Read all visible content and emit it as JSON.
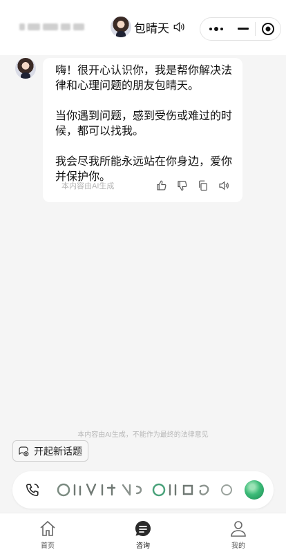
{
  "header": {
    "name": "包晴天"
  },
  "message": {
    "text": "嗨！很开心认识你，我是帮你解决法律和心理问题的朋友包晴天。\n\n当你遇到问题，感到受伤或难过的时候，都可以找我。\n\n我会尽我所能永远站在你身边，爱你并保护你。",
    "ai_note": "本内容由AI生成"
  },
  "disclaimer": "本内容由AI生成，不能作为最终的法律意见",
  "new_topic_label": "开起新话题",
  "tabs": [
    {
      "label": "首页",
      "icon": "home-icon"
    },
    {
      "label": "咨询",
      "icon": "chat-icon",
      "active": true
    },
    {
      "label": "我的",
      "icon": "user-icon"
    }
  ],
  "colors": {
    "background": "#f5f5f5",
    "accent_green": "#3dbb78"
  }
}
